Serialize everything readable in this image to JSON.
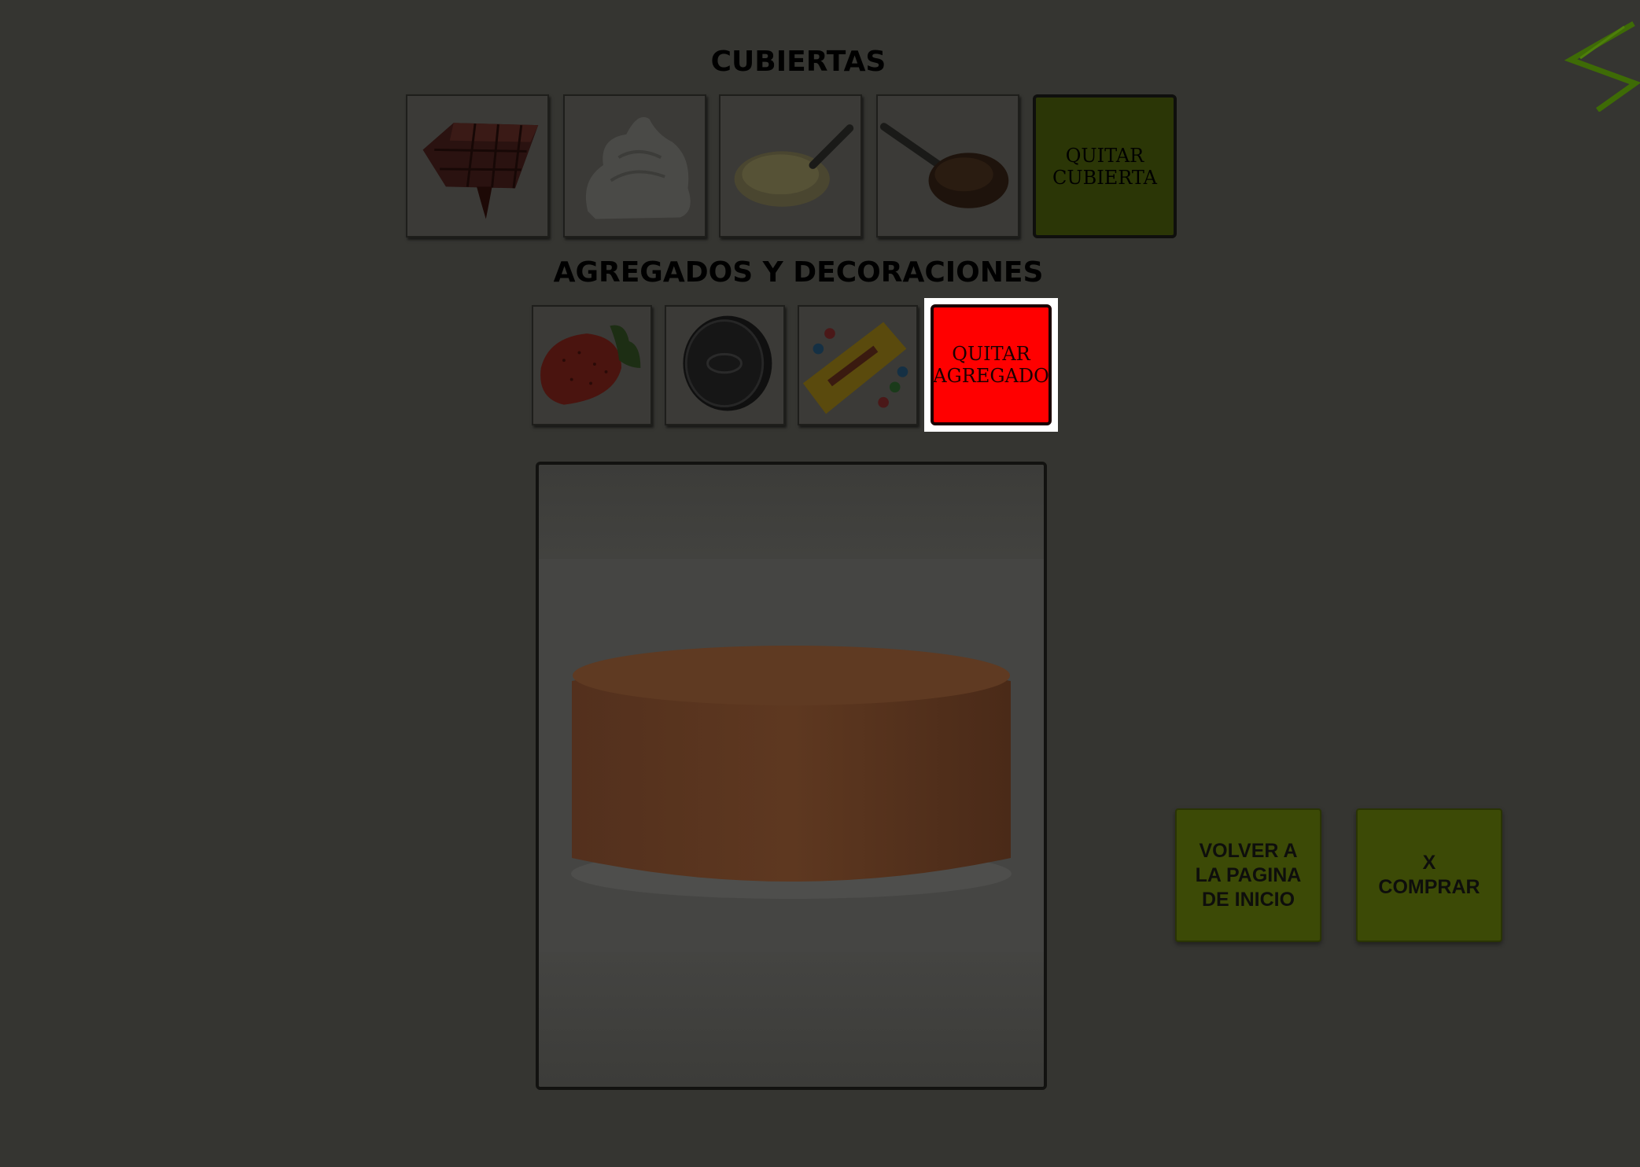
{
  "cubiertas": {
    "title": "CUBIERTAS",
    "items": [
      {
        "name": "chocolate"
      },
      {
        "name": "crema"
      },
      {
        "name": "manjar"
      },
      {
        "name": "nutella"
      }
    ],
    "remove_label": "QUITAR\nCUBIERTA"
  },
  "agregados": {
    "title": "AGREGADOS Y DECORACIONES",
    "items": [
      {
        "name": "frutilla"
      },
      {
        "name": "oreo"
      },
      {
        "name": "m&m's"
      }
    ],
    "remove_label": "QUITAR\nAGREGADO"
  },
  "preview": {
    "icon": "cake-preview"
  },
  "actions": {
    "volver_label": "VOLVER A\nLA PAGINA\nDE INICIO",
    "comprar_label": "X\nCOMPRAR"
  },
  "colors": {
    "overlay_bg": "#353531",
    "olive_button": "#3c4a06",
    "dark_olive_button": "#2b3606",
    "selected_red": "#ff0000",
    "logo_green": "#3e6b06"
  }
}
